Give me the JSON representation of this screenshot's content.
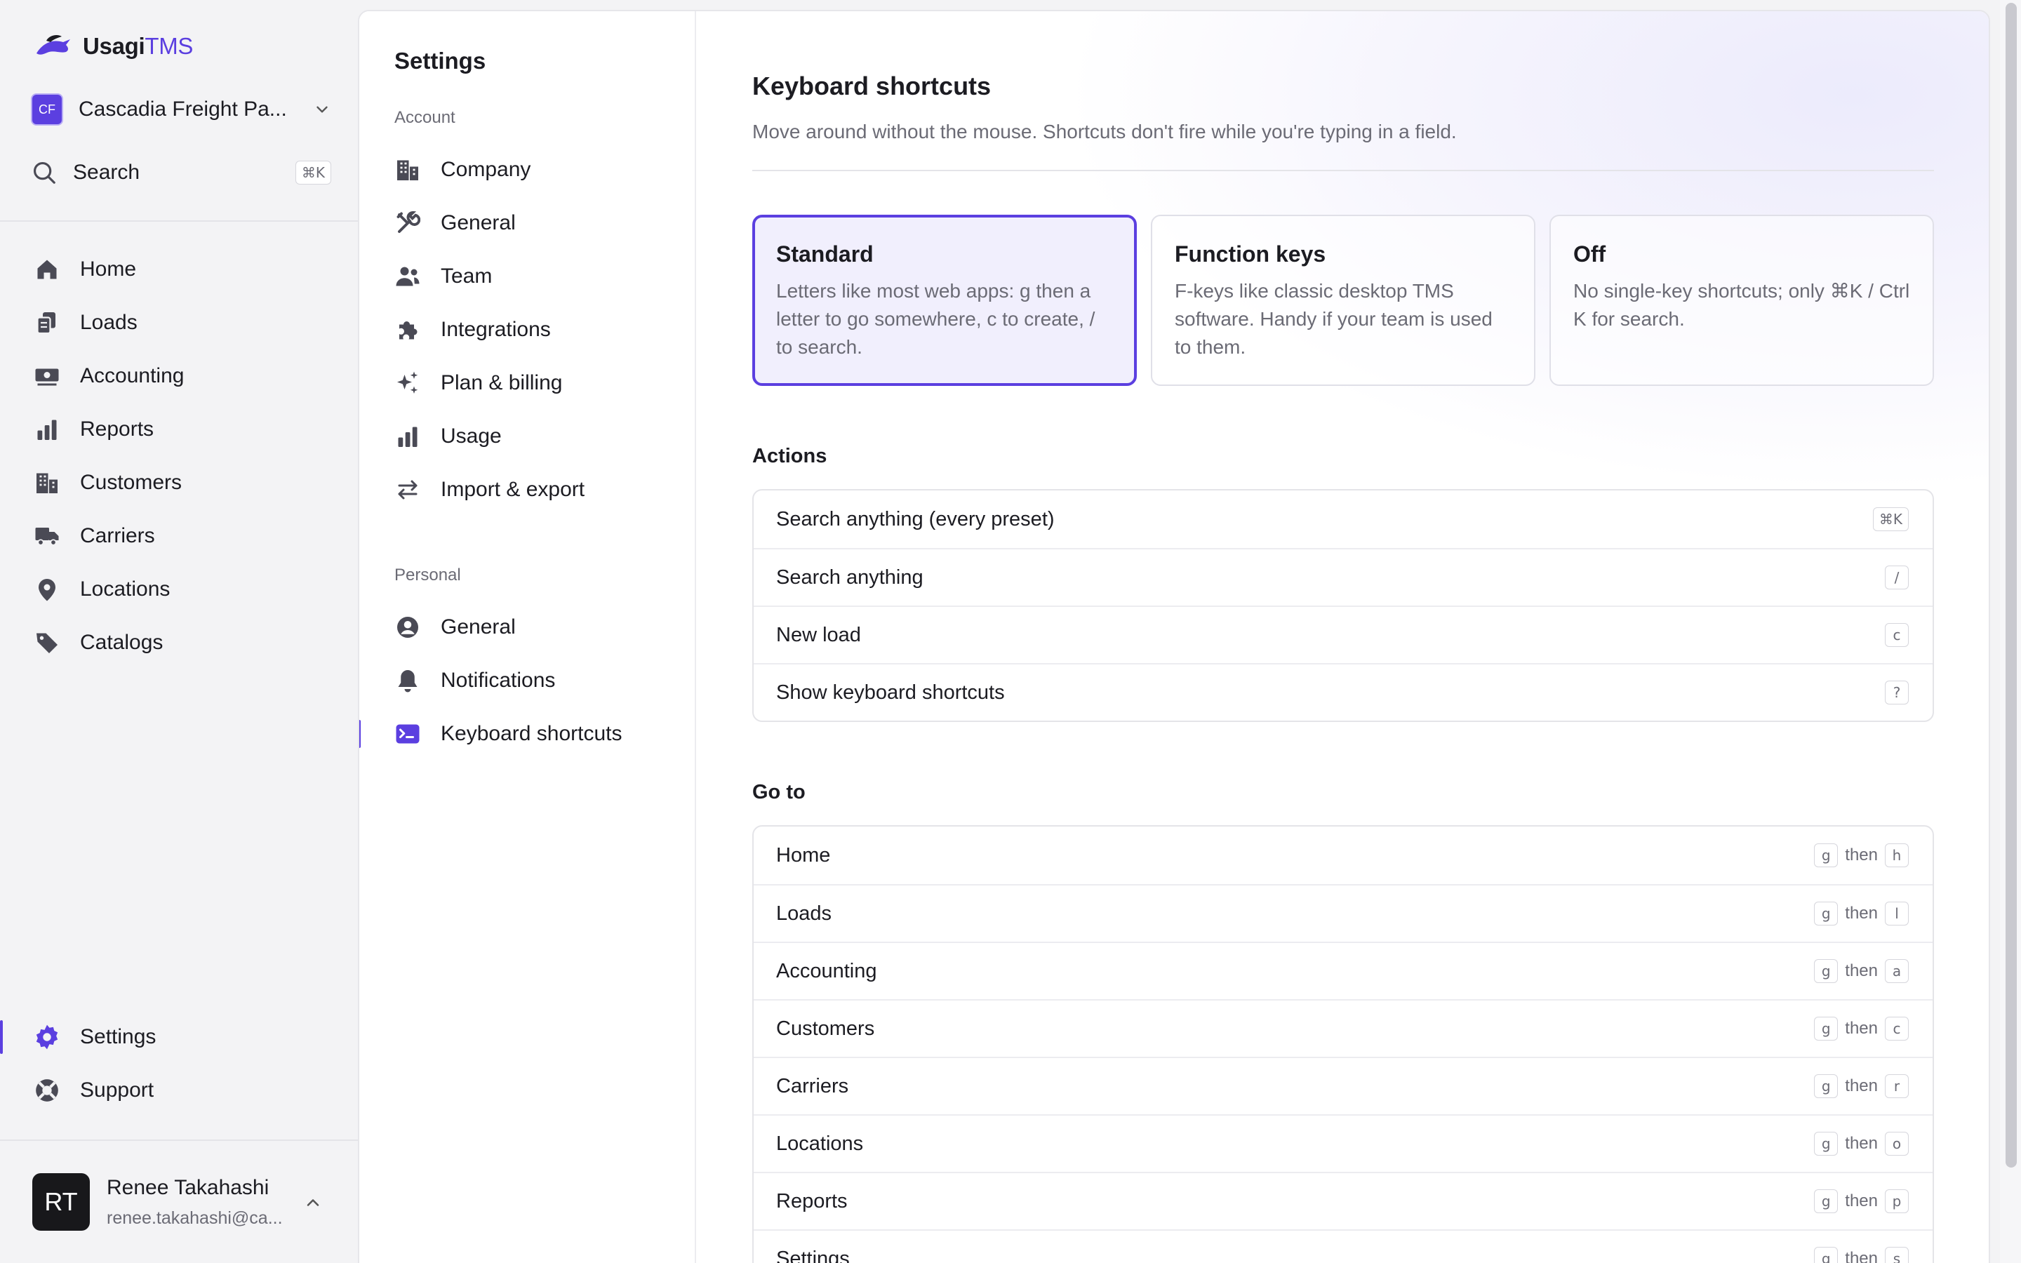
{
  "brand": {
    "name": "Usagi",
    "name_accent": "TMS"
  },
  "org": {
    "badge": "CF",
    "name": "Cascadia Freight Pa..."
  },
  "search": {
    "label": "Search",
    "shortcut": "⌘K"
  },
  "nav": {
    "items": [
      {
        "label": "Home",
        "icon": "home-icon"
      },
      {
        "label": "Loads",
        "icon": "loads-icon"
      },
      {
        "label": "Accounting",
        "icon": "accounting-icon"
      },
      {
        "label": "Reports",
        "icon": "reports-icon"
      },
      {
        "label": "Customers",
        "icon": "customers-icon"
      },
      {
        "label": "Carriers",
        "icon": "truck-icon"
      },
      {
        "label": "Locations",
        "icon": "location-pin-icon"
      },
      {
        "label": "Catalogs",
        "icon": "tag-icon"
      }
    ],
    "bottom": [
      {
        "label": "Settings",
        "icon": "gear-icon",
        "active": true
      },
      {
        "label": "Support",
        "icon": "lifebuoy-icon"
      }
    ]
  },
  "user": {
    "initials": "RT",
    "name": "Renee Takahashi",
    "email": "renee.takahashi@ca..."
  },
  "settings": {
    "title": "Settings",
    "account_label": "Account",
    "account_items": [
      {
        "label": "Company",
        "icon": "building-icon"
      },
      {
        "label": "General",
        "icon": "tools-icon"
      },
      {
        "label": "Team",
        "icon": "team-icon"
      },
      {
        "label": "Integrations",
        "icon": "puzzle-icon"
      },
      {
        "label": "Plan & billing",
        "icon": "sparkles-icon"
      },
      {
        "label": "Usage",
        "icon": "bar-chart-icon"
      },
      {
        "label": "Import & export",
        "icon": "arrows-swap-icon"
      }
    ],
    "personal_label": "Personal",
    "personal_items": [
      {
        "label": "General",
        "icon": "user-circle-icon"
      },
      {
        "label": "Notifications",
        "icon": "bell-icon"
      },
      {
        "label": "Keyboard shortcuts",
        "icon": "terminal-icon",
        "active": true
      }
    ]
  },
  "page": {
    "title": "Keyboard shortcuts",
    "subtitle": "Move around without the mouse. Shortcuts don't fire while you're typing in a field."
  },
  "presets": [
    {
      "title": "Standard",
      "desc": "Letters like most web apps: g then a letter to go somewhere, c to create, / to search.",
      "selected": true
    },
    {
      "title": "Function keys",
      "desc": "F-keys like classic desktop TMS software. Handy if your team is used to them.",
      "selected": false
    },
    {
      "title": "Off",
      "desc": "No single-key shortcuts; only ⌘K / Ctrl K for search.",
      "selected": false
    }
  ],
  "actions": {
    "title": "Actions",
    "rows": [
      {
        "label": "Search anything (every preset)",
        "keys": [
          "⌘K"
        ]
      },
      {
        "label": "Search anything",
        "keys": [
          "/"
        ]
      },
      {
        "label": "New load",
        "keys": [
          "c"
        ]
      },
      {
        "label": "Show keyboard shortcuts",
        "keys": [
          "?"
        ]
      }
    ]
  },
  "goto": {
    "title": "Go to",
    "then_word": "then",
    "rows": [
      {
        "label": "Home",
        "keys": [
          "g",
          "h"
        ]
      },
      {
        "label": "Loads",
        "keys": [
          "g",
          "l"
        ]
      },
      {
        "label": "Accounting",
        "keys": [
          "g",
          "a"
        ]
      },
      {
        "label": "Customers",
        "keys": [
          "g",
          "c"
        ]
      },
      {
        "label": "Carriers",
        "keys": [
          "g",
          "r"
        ]
      },
      {
        "label": "Locations",
        "keys": [
          "g",
          "o"
        ]
      },
      {
        "label": "Reports",
        "keys": [
          "g",
          "p"
        ]
      },
      {
        "label": "Settings",
        "keys": [
          "g",
          "s"
        ]
      }
    ]
  },
  "colors": {
    "accent": "#5b3fe0",
    "text": "#1c1c22",
    "muted": "#6b6b75"
  }
}
